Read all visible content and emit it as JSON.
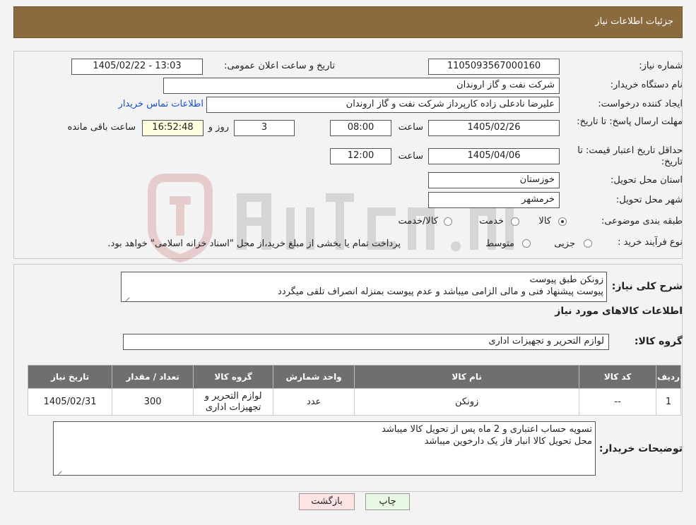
{
  "header": {
    "title": "جزئیات اطلاعات نیاز"
  },
  "form": {
    "need_number_label": "شماره نیاز:",
    "need_number_value": "1105093567000160",
    "announce_label": "تاریخ و ساعت اعلان عمومی:",
    "announce_value": "1405/02/22 - 13:03",
    "buyer_label": "نام دستگاه خریدار:",
    "buyer_value": "شرکت نفت و گاز اروندان",
    "creator_label": "ایجاد کننده درخواست:",
    "creator_value": "علیرضا نادعلی زاده کارپرداز شرکت نفت و گاز اروندان",
    "contact_link": "اطلاعات تماس خریدار",
    "deadline_label": "مهلت ارسال پاسخ: تا تاریخ:",
    "deadline_date": "1405/02/26",
    "time_label": "ساعت",
    "deadline_time": "08:00",
    "days_value": "3",
    "days_label": "روز و",
    "remaining_value": "16:52:48",
    "remaining_label": "ساعت باقی مانده",
    "validity_label": "حداقل تاریخ اعتبار قیمت: تا تاریخ:",
    "validity_date": "1405/04/06",
    "validity_time": "12:00",
    "province_label": "استان محل تحویل:",
    "province_value": "خوزستان",
    "city_label": "شهر محل تحویل:",
    "city_value": "خرمشهر",
    "category_label": "طبقه بندی موضوعی:",
    "category_options": [
      "کالا",
      "خدمت",
      "کالا/خدمت"
    ],
    "category_selected": "کالا",
    "process_label": "نوع فرآیند خرید :",
    "process_options": [
      "جزیی",
      "متوسط"
    ],
    "process_note": "پرداخت تمام یا بخشی از مبلغ خرید،از محل \"اسناد خزانه اسلامی\" خواهد بود."
  },
  "description": {
    "label": "شرح کلی نیاز:",
    "line1": "زونکن طبق پیوست",
    "line2": "پیوست پیشنهاد فنی و مالی الزامی میباشد و عدم پیوست بمنزله انصراف تلقی میگردد"
  },
  "goods_info_title": "اطلاعات کالاهای مورد نیاز",
  "goods_group": {
    "label": "گروه کالا:",
    "value": "لوازم التحریر و تجهیزات اداری"
  },
  "table": {
    "headers": [
      "ردیف",
      "کد کالا",
      "نام کالا",
      "واحد شمارش",
      "گروه کالا",
      "تعداد / مقدار",
      "تاریخ نیاز"
    ],
    "rows": [
      [
        "1",
        "--",
        "زونکن",
        "عدد",
        "لوازم التحریر و تجهیزات اداری",
        "300",
        "1405/02/31"
      ]
    ]
  },
  "buyer_notes": {
    "label": "توضیحات خریدار:",
    "line1": "تسویه حساب اعتباری و 2 ماه پس از تحویل کالا میباشد",
    "line2": "محل تحویل کالا انبار فاز یک دارخوین میباشد"
  },
  "buttons": {
    "print": "چاپ",
    "back": "بازگشت"
  },
  "colors": {
    "header": "#8b6a3e",
    "table_header": "#6f6f6f",
    "link": "#1a4fd6",
    "back_button": "#fde4e4",
    "print_button": "#e9f8e4"
  }
}
